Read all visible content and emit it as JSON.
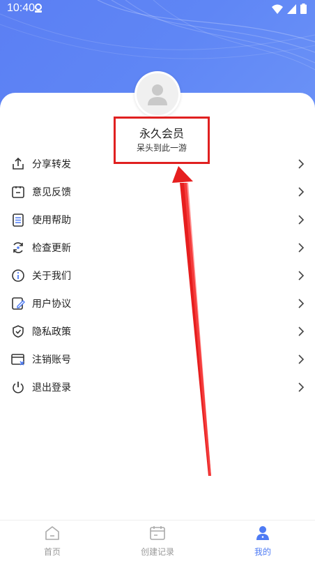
{
  "status_bar": {
    "time": "10:40"
  },
  "profile": {
    "title": "永久会员",
    "subtitle": "呆头到此一游"
  },
  "menu": {
    "items": [
      {
        "label": "分享转发",
        "icon": "share-upload-icon"
      },
      {
        "label": "意见反馈",
        "icon": "feedback-icon"
      },
      {
        "label": "使用帮助",
        "icon": "help-document-icon"
      },
      {
        "label": "检查更新",
        "icon": "refresh-icon"
      },
      {
        "label": "关于我们",
        "icon": "info-icon"
      },
      {
        "label": "用户协议",
        "icon": "agreement-edit-icon"
      },
      {
        "label": "隐私政策",
        "icon": "shield-check-icon"
      },
      {
        "label": "注销账号",
        "icon": "account-close-icon"
      },
      {
        "label": "退出登录",
        "icon": "power-icon"
      }
    ]
  },
  "tabbar": {
    "tabs": [
      {
        "label": "首页",
        "icon": "home-icon",
        "active": false
      },
      {
        "label": "创建记录",
        "icon": "calendar-icon",
        "active": false
      },
      {
        "label": "我的",
        "icon": "user-icon",
        "active": true
      }
    ]
  },
  "colors": {
    "header_blue": "#5f86f5",
    "accent": "#4e7bf4",
    "highlight_red": "#e02020",
    "inactive_tab": "#999999"
  }
}
